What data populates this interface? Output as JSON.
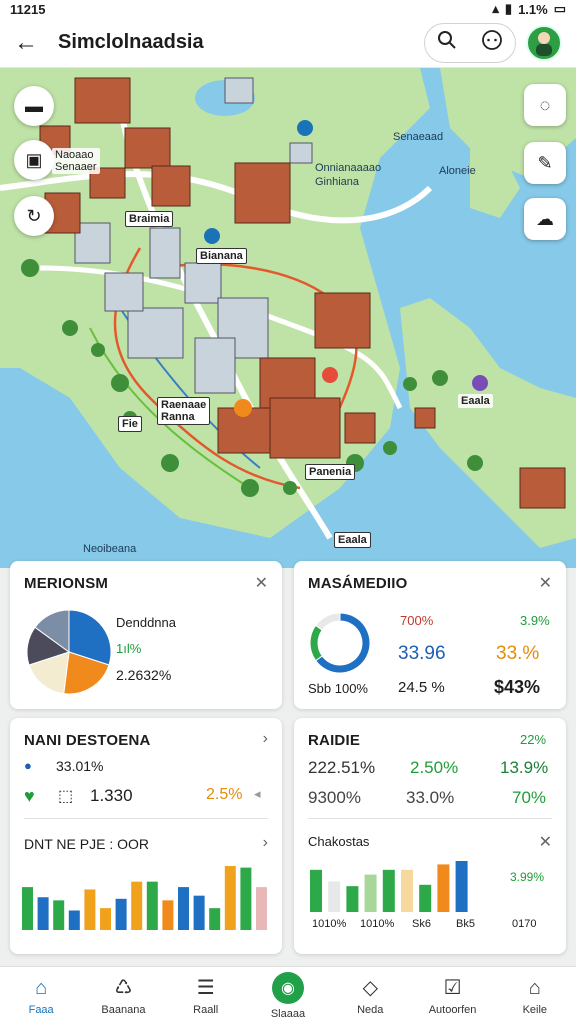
{
  "status_bar": {
    "time": "11215",
    "battery": "1.1%"
  },
  "header": {
    "title": "Simclolnaadsia"
  },
  "map": {
    "labels": {
      "l1": "Naoaao\nSenaaer",
      "l2": "Senaeaad",
      "l3": "Onnianaaaao\nGinhiana",
      "l4": "Aloneie",
      "l5": "Braimia",
      "l6": "Bianana",
      "l7": "Raenaae\nRanna",
      "l8": "Fie",
      "l9": "Panenia",
      "l10": "Eaala",
      "l11": "Neoibeana"
    }
  },
  "cards": {
    "c1": {
      "title": "MERIONSM",
      "legend": "Denddnna",
      "pct1": "1ıl%",
      "pct2": "2.2632%"
    },
    "c2": {
      "title": "MASÁMEDIIO",
      "a": "700%",
      "b": "3.9%",
      "c": "33.96",
      "d": "33.%",
      "e": "Sbb 100%",
      "f": "24.5 %",
      "g": "$43%"
    },
    "c3": {
      "title": "NANI DESTOENA",
      "v1": "33.01%",
      "v2": "1.330",
      "v3": "2.5%",
      "sub": "DNT NE PJE : OOR"
    },
    "c4": {
      "title": "RAIDIE",
      "t1": "22%",
      "r1a": "222.51%",
      "r1b": "2.50%",
      "r1c": "13.9%",
      "r2a": "9300%",
      "r2b": "33.0%",
      "r2c": "70%",
      "sub": "Chakostas",
      "ax": [
        "1010%",
        "1010%",
        "Sk6",
        "Bk5",
        "0170"
      ],
      "legend_val": "3.99%"
    }
  },
  "chart_data": [
    {
      "type": "pie",
      "values": [
        30,
        22,
        18,
        15,
        15
      ],
      "colors": [
        "#1f6fc2",
        "#f08a1c",
        "#f4ecd0",
        "#4b4b5b",
        "#7b8ea6"
      ]
    },
    {
      "type": "pie",
      "values": [
        65,
        20,
        15
      ],
      "colors": [
        "#1f6fc2",
        "#2ea94a",
        "#e8e8e8"
      ]
    },
    {
      "type": "bar",
      "values": [
        0.55,
        0.42,
        0.38,
        0.25,
        0.52,
        0.28,
        0.4,
        0.62,
        0.62,
        0.38,
        0.55,
        0.44,
        0.28,
        0.82,
        0.8,
        0.55
      ],
      "colors": [
        "#2ea94a",
        "#1f6fc2",
        "#2ea94a",
        "#1f6fc2",
        "#f0a21c",
        "#f0a21c",
        "#1f6fc2",
        "#f0a21c",
        "#2ea94a",
        "#f08a1c",
        "#1f6fc2",
        "#1f6fc2",
        "#2ea94a",
        "#f0a21c",
        "#2ea94a",
        "#e8b8b8"
      ]
    },
    {
      "type": "bar",
      "values": [
        0.62,
        0.45,
        0.38,
        0.55,
        0.62,
        0.62,
        0.4,
        0.7,
        0.75
      ],
      "colors": [
        "#2ea94a",
        "#e8e8e8",
        "#2ea94a",
        "#a7d89a",
        "#2ea94a",
        "#f7d9a0",
        "#2ea94a",
        "#f08a1c",
        "#1f6fc2"
      ]
    }
  ],
  "nav": {
    "items": [
      "Faaa",
      "Baanana",
      "Raall",
      "Slaaaa",
      "Neda",
      "Autoorfen",
      "Keile"
    ]
  }
}
